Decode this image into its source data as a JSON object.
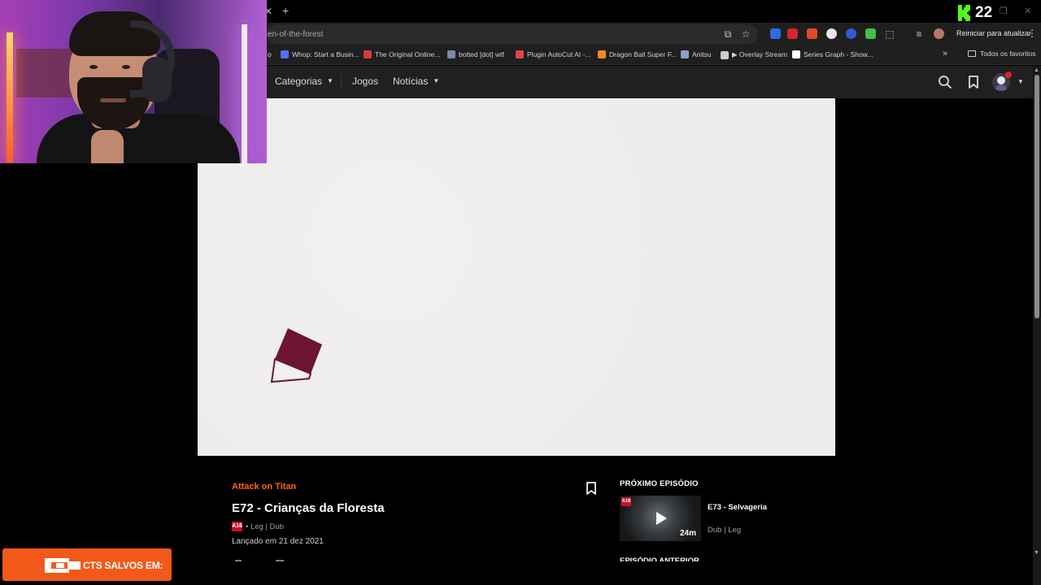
{
  "browser": {
    "url": "en-of-the-forest",
    "restart_button": "Reiniciar para atualizar",
    "kick_count": "22",
    "bookmarks": [
      {
        "label": "o",
        "color": "#888888"
      },
      {
        "label": "Whop: Start a Busin...",
        "color": "#5a6bff"
      },
      {
        "label": "The Original Online...",
        "color": "#d83a3a"
      },
      {
        "label": "botted [dot] wtf",
        "color": "#7a8aa8"
      },
      {
        "label": "Plugin AutoCut AI -...",
        "color": "#e04848"
      },
      {
        "label": "Dragon Ball Super F...",
        "color": "#f08a1a"
      },
      {
        "label": "Anitsu",
        "color": "#8aa0d0"
      },
      {
        "label": "▶ Overlay Stream",
        "color": "#cfcfcf"
      },
      {
        "label": "Series Graph - Show...",
        "color": "#ffffff"
      }
    ],
    "bookmarks_more": "»",
    "all_bookmarks": "Todos os favoritos"
  },
  "site": {
    "nav": {
      "categories": "Categorias",
      "games": "Jogos",
      "news": "Notícias"
    }
  },
  "episode": {
    "series": "Attack on Titan",
    "title": "E72 - Crianças da Floresta",
    "age_rating": "A16",
    "audio": "• Leg | Dub",
    "release": "Lançado em 21 dez 2021"
  },
  "next_episode": {
    "label": "PRÓXIMO EPISÓDIO",
    "title": "E73 - Selvageria",
    "meta": "Dub | Leg",
    "duration": "24m",
    "age_rating": "A16"
  },
  "previous_episode": {
    "label": "EPISÓDIO ANTERIOR"
  },
  "overlay": {
    "saved_text": "CTS SALVOS EM:"
  },
  "colors": {
    "accent_orange": "#ff640a",
    "age_badge_red": "#c8102e",
    "player_paper": "#edecea",
    "book_maroon": "#6b1530",
    "banner_orange": "#f2591a"
  }
}
